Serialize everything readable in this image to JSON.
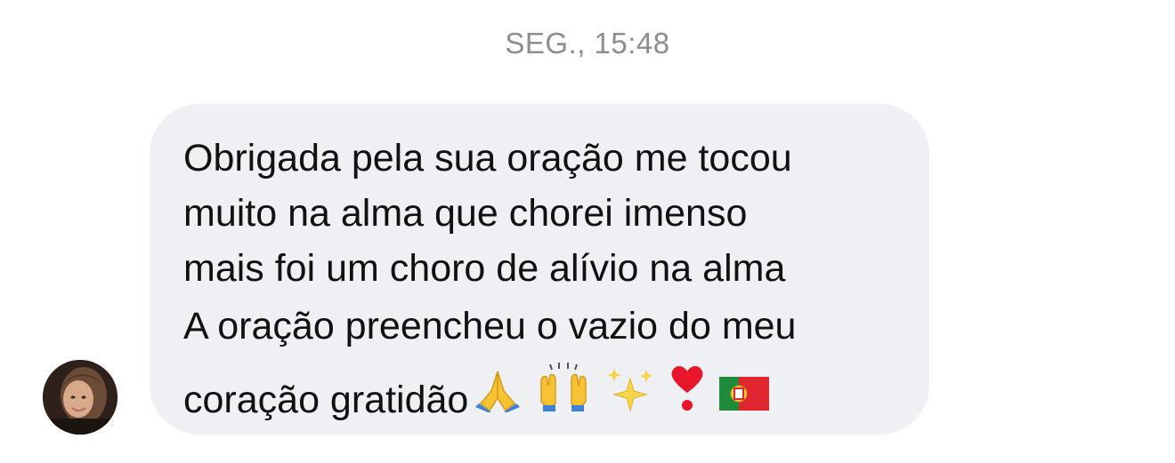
{
  "conversation": {
    "timestamp": "SEG., 15:48"
  },
  "message": {
    "lines": [
      "Obrigada pela sua oração me tocou",
      "muito na alma que chorei imenso",
      "mais foi um choro de alívio na alma",
      "A oração preencheu  o vazio do meu",
      "coração gratidão"
    ],
    "emojis": [
      "folded-hands-icon",
      "raising-hands-icon",
      "sparkles-icon",
      "heart-exclamation-icon",
      "portugal-flag-icon"
    ]
  },
  "colors": {
    "bubble": "#eff0f4",
    "timestamp": "#8a8d93",
    "text": "#111111"
  }
}
